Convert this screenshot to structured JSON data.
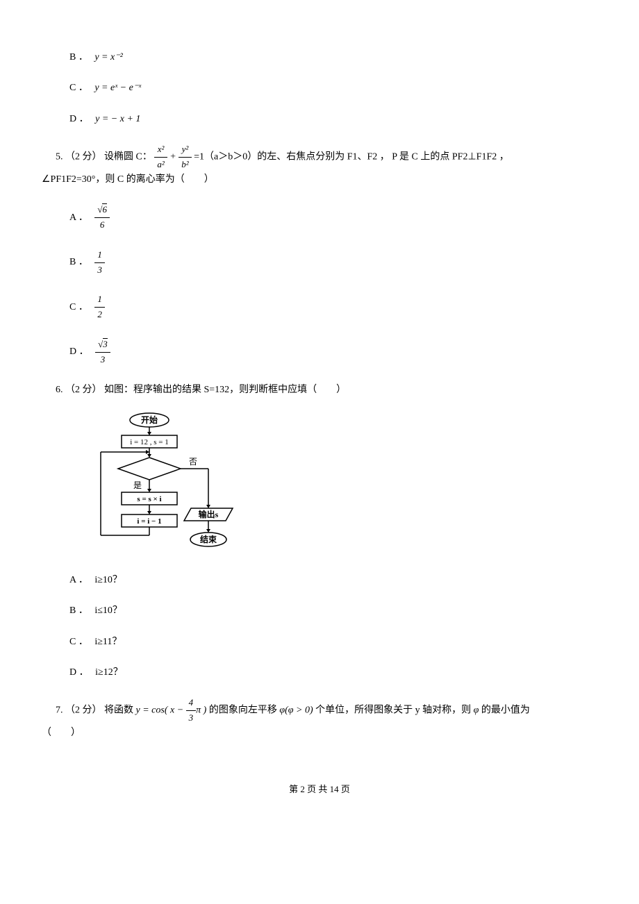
{
  "q4": {
    "optB_label": "B ．",
    "optB_expr": "y = x⁻²",
    "optC_label": "C ．",
    "optC_expr": "y = eˣ − e⁻ˣ",
    "optD_label": "D ．",
    "optD_expr": "y = − x + 1"
  },
  "q5": {
    "prefix": "5.  （2 分）  设椭圆 C：",
    "eq_num1": "x²",
    "eq_den1": "a²",
    "eq_plus": " + ",
    "eq_num2": "y²",
    "eq_den2": "b²",
    "eq_tail": " =1（a＞b＞0）的左、右焦点分别为 F1、F2 ，  P 是 C 上的点 PF2⊥F1F2 ，",
    "line2": "∠PF1F2=30°，则 C 的离心率为（　　）",
    "optA_label": "A ．",
    "optA_num": "6",
    "optA_den": "6",
    "optB_label": "B ．",
    "optB_num": "1",
    "optB_den": "3",
    "optC_label": "C ．",
    "optC_num": "1",
    "optC_den": "2",
    "optD_label": "D ．",
    "optD_num": "3",
    "optD_den": "3"
  },
  "q6": {
    "text": "6.  （2 分）  如图：程序输出的结果 S=132，则判断框中应填（　　）",
    "flow": {
      "start": "开始",
      "init": "i = 12 , s = 1",
      "no": "否",
      "yes": "是",
      "assign_s": "s = s × i",
      "assign_i": "i = i − 1",
      "output": "输出s",
      "end": "结束"
    },
    "optA_label": "A ．",
    "optA_text": "i≥10？",
    "optB_label": "B ．",
    "optB_text": "i≤10？",
    "optC_label": "C ．",
    "optC_text": "i≥11？",
    "optD_label": "D ．",
    "optD_text": "i≥12？"
  },
  "q7": {
    "prefix": "7.  （2 分）  将函数",
    "expr": "y = cos( x − ",
    "frac_num": "4",
    "frac_den": "3",
    "expr_tail": "π )",
    "mid": "的图象向左平移",
    "phi": "φ(φ > 0)",
    "tail": "个单位，所得图象关于 y 轴对称，则",
    "phi2": "φ",
    "tail2": "的最小值为",
    "line2": "（　　）"
  },
  "footer": {
    "text": "第 2 页 共 14 页"
  }
}
